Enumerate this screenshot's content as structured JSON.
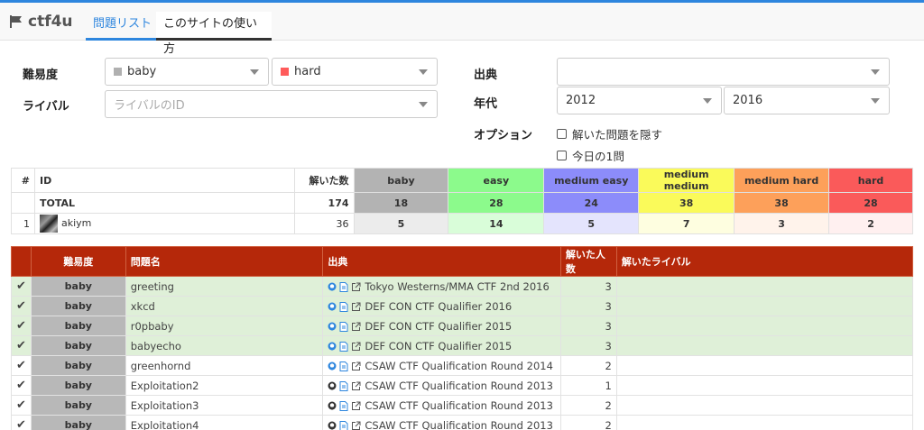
{
  "nav": {
    "brand": "ctf4u",
    "tabs": [
      {
        "label": "問題リスト",
        "active": true
      },
      {
        "label": "このサイトの使い方",
        "active": false
      }
    ]
  },
  "filters": {
    "difficulty_label": "難易度",
    "difficulty_from": {
      "value": "baby",
      "color": "#b0b0b0"
    },
    "difficulty_to": {
      "value": "hard",
      "color": "#ff5b5b"
    },
    "rival_label": "ライバル",
    "rival_placeholder": "ライバルのID",
    "source_label": "出典",
    "source_value": "",
    "year_label": "年代",
    "year_from": "2012",
    "year_to": "2016",
    "options_label": "オプション",
    "options": [
      {
        "label": "解いた問題を隠す",
        "checked": false
      },
      {
        "label": "今日の1問",
        "checked": false
      }
    ]
  },
  "stats": {
    "headers": {
      "rank": "#",
      "id": "ID",
      "solved": "解いた数"
    },
    "levels": [
      {
        "name": "baby",
        "color": "#b3b3b3",
        "light": "#ececec"
      },
      {
        "name": "easy",
        "color": "#8cfa8c",
        "light": "#d9fdd9"
      },
      {
        "name": "medium easy",
        "color": "#8c8cfa",
        "light": "#e4e4fd"
      },
      {
        "name": "medium medium",
        "color": "#fafa5a",
        "light": "#fefee0"
      },
      {
        "name": "medium hard",
        "color": "#fda05a",
        "light": "#fff3eb"
      },
      {
        "name": "hard",
        "color": "#fa5a5a",
        "light": "#fff0f0"
      }
    ],
    "total": {
      "label": "TOTAL",
      "solved": "174",
      "counts": [
        "18",
        "28",
        "24",
        "38",
        "38",
        "28"
      ]
    },
    "users": [
      {
        "rank": "1",
        "id": "akiym",
        "solved": "36",
        "counts": [
          "5",
          "14",
          "5",
          "7",
          "3",
          "2"
        ]
      }
    ]
  },
  "problems": {
    "headers": {
      "difficulty": "難易度",
      "name": "問題名",
      "source": "出典",
      "solvers": "解いた人数",
      "rivals": "解いたライバル"
    },
    "rows": [
      {
        "solved": true,
        "difficulty": "baby",
        "name": "greeting",
        "source": "Tokyo Westerns/MMA CTF 2nd 2016",
        "solvers": "3",
        "rivals": "",
        "github": true
      },
      {
        "solved": true,
        "difficulty": "baby",
        "name": "xkcd",
        "source": "DEF CON CTF Qualifier 2016",
        "solvers": "3",
        "rivals": "",
        "github": true
      },
      {
        "solved": true,
        "difficulty": "baby",
        "name": "r0pbaby",
        "source": "DEF CON CTF Qualifier 2015",
        "solvers": "3",
        "rivals": "",
        "github": true
      },
      {
        "solved": true,
        "difficulty": "baby",
        "name": "babyecho",
        "source": "DEF CON CTF Qualifier 2015",
        "solvers": "3",
        "rivals": "",
        "github": true
      },
      {
        "solved": false,
        "difficulty": "baby",
        "name": "greenhornd",
        "source": "CSAW CTF Qualification Round 2014",
        "solvers": "2",
        "rivals": "",
        "github": true
      },
      {
        "solved": false,
        "difficulty": "baby",
        "name": "Exploitation2",
        "source": "CSAW CTF Qualification Round 2013",
        "solvers": "1",
        "rivals": "",
        "github": false
      },
      {
        "solved": false,
        "difficulty": "baby",
        "name": "Exploitation3",
        "source": "CSAW CTF Qualification Round 2013",
        "solvers": "2",
        "rivals": "",
        "github": false
      },
      {
        "solved": false,
        "difficulty": "baby",
        "name": "Exploitation4",
        "source": "CSAW CTF Qualification Round 2013",
        "solvers": "2",
        "rivals": "",
        "github": false
      }
    ]
  }
}
